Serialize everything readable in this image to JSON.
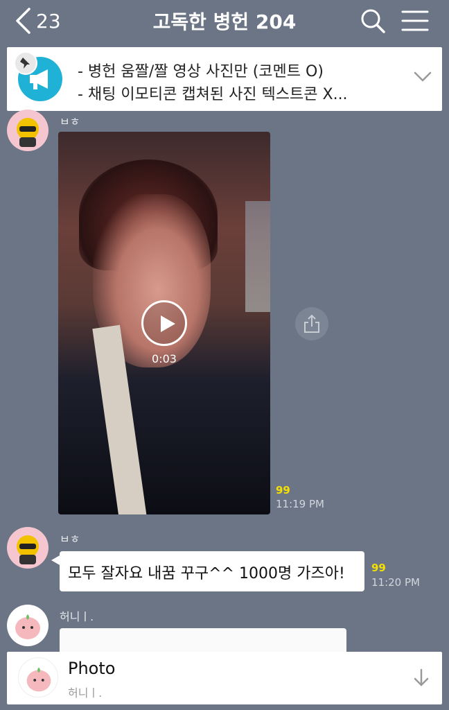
{
  "header": {
    "back_count": "23",
    "title": "고독한 병헌 204"
  },
  "notice": {
    "line1": "- 병헌 움짤/짤 영상 사진만 (코멘트 O)",
    "line2": "- 채팅 이모티콘 캡쳐된 사진 텍스트콘 X..."
  },
  "messages": [
    {
      "sender": "ㅂㅎ",
      "type": "video",
      "duration": "0:03",
      "read_count": "99",
      "time": "11:19 PM"
    },
    {
      "sender": "ㅂㅎ",
      "type": "text",
      "text": "모두 잘자요 내꿈 꾸구^^ 1000명 가즈아!",
      "read_count": "99",
      "time": "11:20 PM"
    },
    {
      "sender": "허니ㅣ.",
      "type": "photo"
    }
  ],
  "bottom_notification": {
    "title": "Photo",
    "subtitle": "허니ㅣ."
  },
  "colors": {
    "background": "#6b7585",
    "read_count": "#f5e000",
    "notice_icon": "#1fb1d6"
  }
}
